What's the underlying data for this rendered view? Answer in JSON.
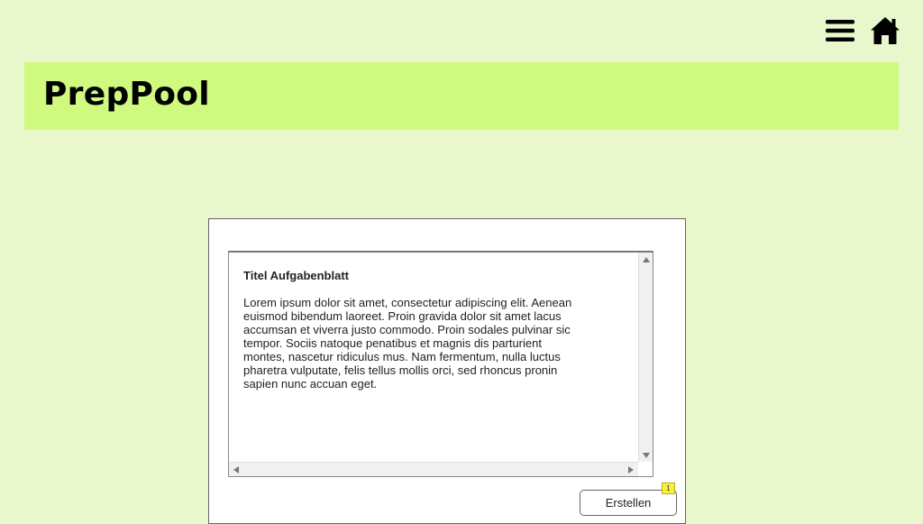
{
  "app": {
    "title": "PrepPool"
  },
  "top_nav": {
    "menu_icon": "hamburger-menu-icon",
    "home_icon": "home-icon"
  },
  "document": {
    "title": "Titel Aufgabenblatt",
    "body": "Lorem ipsum dolor sit amet, consectetur adipiscing elit. Aenean euismod bibendum laoreet. Proin gravida dolor sit amet lacus accumsan et viverra justo commodo. Proin sodales pulvinar sic tempor. Sociis natoque penatibus et magnis dis parturient montes, nascetur ridiculus mus. Nam fermentum, nulla luctus pharetra vulputate, felis tellus mollis orci, sed rhoncus pronin sapien nunc accuan eget."
  },
  "actions": {
    "create_label": "Erstellen",
    "badge_count": "1"
  },
  "colors": {
    "page_background": "#e8f8cc",
    "header_background": "#cffa7f",
    "badge_background": "#f6f040"
  }
}
